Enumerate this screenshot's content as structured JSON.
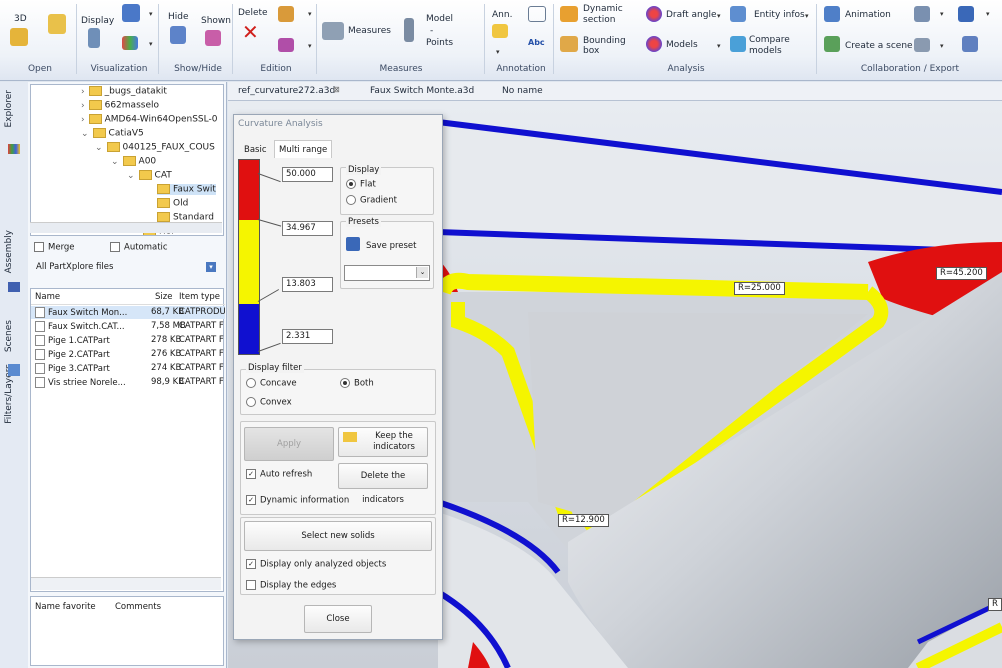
{
  "ribbon": {
    "groups": [
      "Open",
      "Visualization",
      "Show/Hide",
      "Edition",
      "Measures",
      "Annotation",
      "Analysis",
      "Collaboration / Export"
    ],
    "buttons": {
      "three_d": "3D",
      "display": "Display",
      "hide": "Hide",
      "shown": "Shown",
      "delete": "Delete",
      "measures": "Measures",
      "model_points": [
        "Model",
        "-",
        "Points"
      ],
      "ann": "Ann.",
      "dynamic_section": [
        "Dynamic",
        "section"
      ],
      "bounding_box": [
        "Bounding",
        "box"
      ],
      "draft_angle": "Draft angle",
      "models": "Models",
      "entity_infos": "Entity infos",
      "compare_models": [
        "Compare",
        "models"
      ],
      "animation": "Animation",
      "create_scene": "Create a scene"
    }
  },
  "sidebar_tabs": [
    "Explorer",
    "Assembly",
    "Scenes",
    "Filters/Layers"
  ],
  "tree": [
    "_bugs_datakit",
    "662masselo",
    "AMD64-Win64OpenSSL-0",
    "CatiaV5",
    "040125_FAUX_COUS",
    "A00",
    "CAT",
    "Faux Swit",
    "Old",
    "Standard",
    "RCP"
  ],
  "merge_label": "Merge",
  "automatic_label": "Automatic",
  "filter_value": "All PartXplore files",
  "files": {
    "headers": [
      "Name",
      "Size",
      "Item type"
    ],
    "rows": [
      {
        "name": "Faux Switch Mon...",
        "size": "68,7 KB",
        "type": "CATPRODU"
      },
      {
        "name": "Faux Switch.CAT...",
        "size": "7,58 MB",
        "type": "CATPART F"
      },
      {
        "name": "Pige 1.CATPart",
        "size": "278 KB",
        "type": "CATPART F"
      },
      {
        "name": "Pige 2.CATPart",
        "size": "276 KB",
        "type": "CATPART F"
      },
      {
        "name": "Pige 3.CATPart",
        "size": "274 KB",
        "type": "CATPART F"
      },
      {
        "name": "Vis striee Norele...",
        "size": "98,9 KB",
        "type": "CATPART F"
      }
    ]
  },
  "favorites": {
    "headers": [
      "Name favorite",
      "Comments"
    ]
  },
  "doc_tabs": [
    "ref_curvature272.a3d",
    "Faux Switch Monte.a3d",
    "No name"
  ],
  "dialog": {
    "title": "Curvature Analysis",
    "tabs": [
      "Basic",
      "Multi range"
    ],
    "values": [
      "50.000",
      "34.967",
      "13.803",
      "2.331"
    ],
    "display_group": "Display",
    "display_options": [
      "Flat",
      "Gradient"
    ],
    "presets_group": "Presets",
    "save_preset": "Save preset",
    "display_filter_group": "Display filter",
    "filter_options": [
      "Concave",
      "Both",
      "Convex"
    ],
    "apply": "Apply",
    "keep_indicators": [
      "Keep the",
      "indicators"
    ],
    "auto_refresh": "Auto refresh",
    "delete_indicators": "Delete the indicators",
    "dynamic_information": "Dynamic information",
    "select_new_solids": "Select new solids",
    "display_only_analyzed": "Display only analyzed objects",
    "display_edges": "Display the edges",
    "close": "Close"
  },
  "callouts": [
    "R=25.000",
    "R=45.200",
    "R=12.900",
    "R"
  ],
  "colors": {
    "red": "#e01010",
    "yellow": "#f5f500",
    "blue": "#1010d0"
  }
}
